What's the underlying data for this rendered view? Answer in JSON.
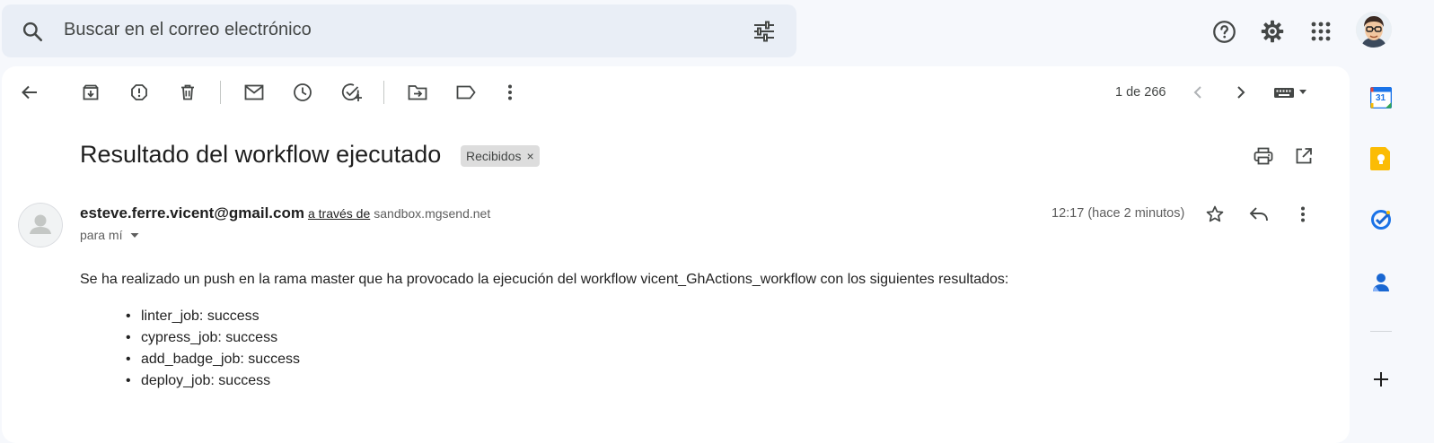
{
  "search": {
    "placeholder": "Buscar en el correo electrónico"
  },
  "toolbar": {
    "pagination": "1 de 266"
  },
  "message": {
    "subject": "Resultado del workflow ejecutado",
    "label_chip": "Recibidos",
    "chip_remove": "×",
    "sender_email": "esteve.ferre.vicent@gmail.com",
    "via_text": "a través de",
    "via_domain": "sandbox.mgsend.net",
    "recipient": "para mí",
    "time": "12:17 (hace 2 minutos)",
    "body_intro": "Se ha realizado un push en la rama master que ha provocado la ejecución del workflow vicent_GhActions_workflow con los siguientes resultados:",
    "results": [
      "linter_job: success",
      "cypress_job: success",
      "add_badge_job: success",
      "deploy_job: success"
    ]
  },
  "side_panel": {
    "calendar_day": "31",
    "calendar_color": "#1a73e8",
    "keep_color": "#fbbc04",
    "tasks_color": "#1a73e8",
    "contacts_color": "#1967d2"
  },
  "icons": {
    "top": [
      "search-icon",
      "search-options-icon",
      "help-icon",
      "settings-icon",
      "apps-icon",
      "account-avatar"
    ],
    "toolbar": [
      "back-icon",
      "archive-icon",
      "report-spam-icon",
      "delete-icon",
      "mark-unread-icon",
      "snooze-icon",
      "add-to-tasks-icon",
      "move-to-icon",
      "label-icon",
      "more-icon",
      "newer-icon",
      "older-icon",
      "input-tools-icon"
    ],
    "message": [
      "print-icon",
      "open-in-new-window-icon",
      "star-icon",
      "reply-icon",
      "more-vert-icon"
    ]
  }
}
